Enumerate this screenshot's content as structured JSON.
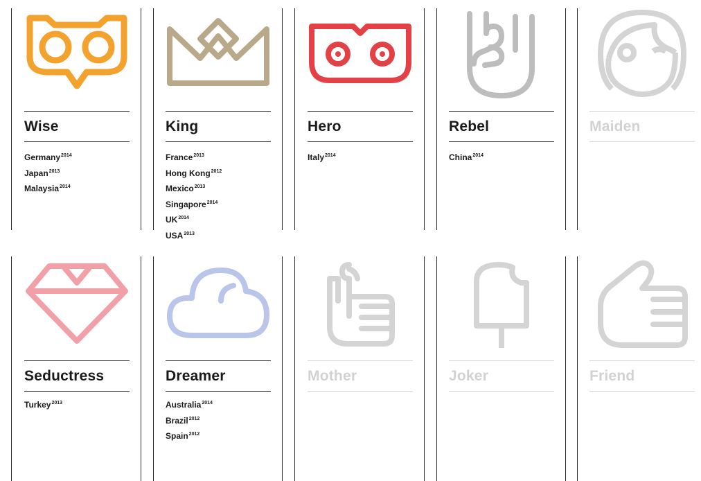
{
  "colors": {
    "wise": "#f4a22e",
    "king": "#b7a98a",
    "hero": "#e24246",
    "rebel": "#bdbdbd",
    "maiden": "#d4d4d4",
    "seductress": "#f0a0a6",
    "dreamer": "#b9c6ea",
    "mother": "#d4d4d4",
    "joker": "#d4d4d4",
    "friend": "#d4d4d4"
  },
  "archetypes": [
    {
      "name": "Wise",
      "icon": "owl-icon",
      "countries": [
        {
          "name": "Germany",
          "year": "2014"
        },
        {
          "name": "Japan",
          "year": "2013"
        },
        {
          "name": "Malaysia",
          "year": "2014"
        }
      ]
    },
    {
      "name": "King",
      "icon": "crown-icon",
      "countries": [
        {
          "name": "France",
          "year": "2013"
        },
        {
          "name": "Hong Kong",
          "year": "2012"
        },
        {
          "name": "Mexico",
          "year": "2013"
        },
        {
          "name": "Singapore",
          "year": "2014"
        },
        {
          "name": "UK",
          "year": "2014"
        },
        {
          "name": "USA",
          "year": "2013"
        }
      ]
    },
    {
      "name": "Hero",
      "icon": "hero-mask-icon",
      "countries": [
        {
          "name": "Italy",
          "year": "2014"
        }
      ]
    },
    {
      "name": "Rebel",
      "icon": "rock-hand-icon",
      "countries": [
        {
          "name": "China",
          "year": "2014"
        }
      ]
    },
    {
      "name": "Maiden",
      "icon": "maiden-face-icon",
      "countries": []
    },
    {
      "name": "Seductress",
      "icon": "diamond-icon",
      "countries": [
        {
          "name": "Turkey",
          "year": "2013"
        }
      ]
    },
    {
      "name": "Dreamer",
      "icon": "cloud-icon",
      "countries": [
        {
          "name": "Australia",
          "year": "2014"
        },
        {
          "name": "Brazil",
          "year": "2012"
        },
        {
          "name": "Spain",
          "year": "2012"
        }
      ]
    },
    {
      "name": "Mother",
      "icon": "reminder-hand-icon",
      "countries": []
    },
    {
      "name": "Joker",
      "icon": "bitten-popsicle-icon",
      "countries": []
    },
    {
      "name": "Friend",
      "icon": "thumbs-up-icon",
      "countries": []
    }
  ]
}
